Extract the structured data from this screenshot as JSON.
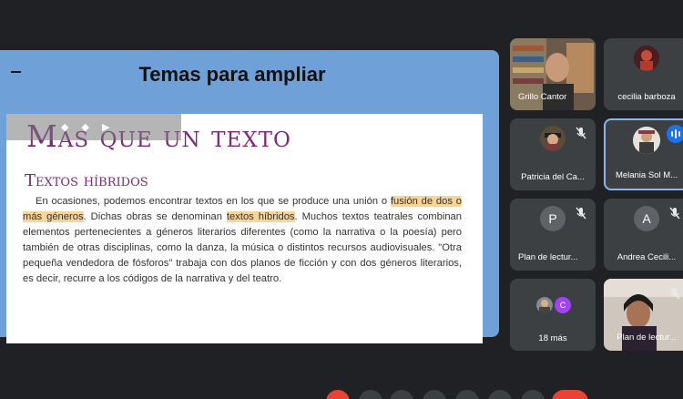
{
  "presentation": {
    "title": "Temas para ampliar",
    "document": {
      "heading": "Más que un texto",
      "subheading": "Textos híbridos",
      "paragraph": {
        "part1": "En ocasiones, podemos encontrar textos en los que se produce una unión o ",
        "highlight1": "fusión de dos o más géneros",
        "part2": ". Dichas obras se denominan ",
        "highlight2": "textos híbridos",
        "part3": ". Muchos textos teatrales combinan elementos pertenecientes a géneros literarios diferentes (como la narrativa o la poesía) pero también de otras disciplinas, como la danza, la música o distintos recursos audiovisuales. \"Otra pequeña vendedora de fósforos\" trabaja con dos planos de ficción y con dos géneros literarios, es decir, recurre a los códigos de la narrativa y del teatro."
      }
    }
  },
  "participants": [
    {
      "name": "Grillo Cantor",
      "initial": "",
      "avatar_color": "",
      "muted": false,
      "speaking": false
    },
    {
      "name": "cecilia barboza",
      "initial": "",
      "avatar_color": "",
      "muted": false,
      "speaking": false
    },
    {
      "name": "Patricia del Ca...",
      "initial": "",
      "avatar_color": "",
      "muted": true,
      "speaking": false
    },
    {
      "name": "Melania Sol M...",
      "initial": "",
      "avatar_color": "",
      "muted": false,
      "speaking": true
    },
    {
      "name": "Plan de lectur...",
      "initial": "P",
      "avatar_color": "#5f6368",
      "muted": true,
      "speaking": false
    },
    {
      "name": "Andrea Cecili...",
      "initial": "A",
      "avatar_color": "#5f6368",
      "muted": true,
      "speaking": false
    },
    {
      "name": "18 más",
      "initial": "C",
      "avatar_color": "#a142f4",
      "muted": false,
      "speaking": false
    },
    {
      "name": "Plan de lectur...",
      "initial": "",
      "avatar_color": "",
      "muted": true,
      "speaking": false
    }
  ],
  "colors": {
    "background": "#202124",
    "tile": "#3c4043",
    "presentation_bg": "#6fa1d8",
    "heading": "#7b2a78",
    "highlight": "#f7d49a",
    "active_border": "#8ab4f8",
    "speaking_indicator": "#1a73e8",
    "end_call": "#ea4335"
  },
  "icons": {
    "minimize": "minimize-icon",
    "mic_off": "mic-off-icon",
    "speaking": "audio-level-icon"
  }
}
